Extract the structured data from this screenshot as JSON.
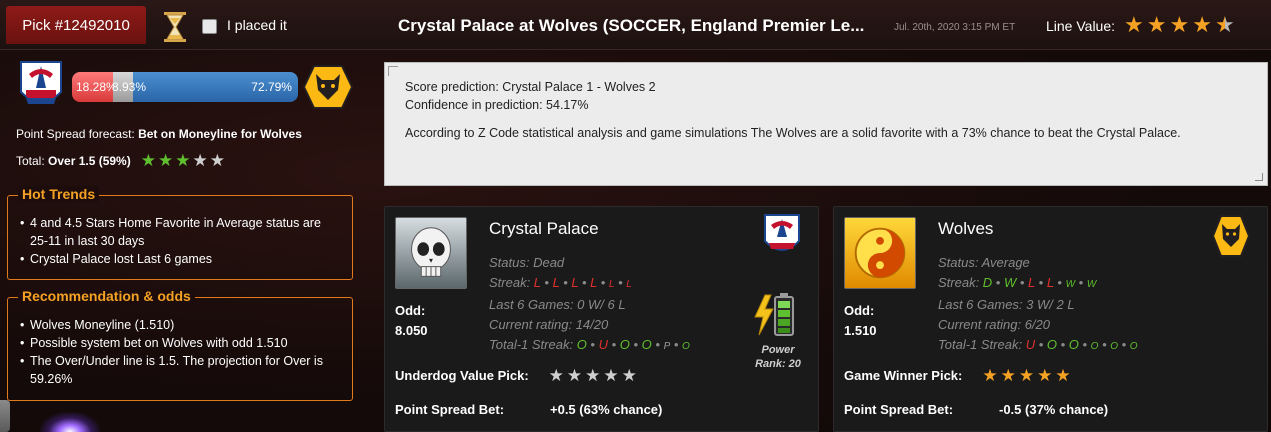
{
  "header": {
    "pick_label": "Pick #12492010",
    "placed_label": "I placed it",
    "match_title": "Crystal Palace at Wolves (SOCCER, England Premier Le...",
    "date": "Jul. 20th, 2020 3:15 PM ET",
    "line_value_label": "Line Value:",
    "line_value_stars": 4.5,
    "line_star_glyphs": [
      "★",
      "★",
      "★",
      "★",
      "★"
    ]
  },
  "probabilities": {
    "home": "18.28%",
    "draw": "8.93%",
    "away": "72.79%",
    "home_value": 18.28,
    "draw_value": 8.93,
    "away_value": 72.79
  },
  "forecast": {
    "spread_prefix": "Point Spread forecast: ",
    "spread_value": "Bet on Moneyline for Wolves",
    "total_prefix": "Total: ",
    "total_value": "Over 1.5 (59%)",
    "total_stars": 3,
    "total_star_glyphs": [
      "★",
      "★",
      "★",
      "★",
      "★"
    ]
  },
  "hot_trends": {
    "title": "Hot Trends",
    "items": [
      "4 and 4.5 Stars Home Favorite in Average status are 25-11 in last 30 days",
      "Crystal Palace lost Last 6 games"
    ]
  },
  "recommendation": {
    "title": "Recommendation & odds",
    "items": [
      "Wolves Moneyline (1.510)",
      "Possible system bet on Wolves with odd 1.510",
      "The Over/Under line is 1.5. The projection for Over is 59.26%"
    ]
  },
  "prediction": {
    "score": "Score prediction: Crystal Palace 1 - Wolves 2",
    "confidence": "Confidence in prediction: 54.17%",
    "analysis": "According to Z Code statistical analysis and game simulations The Wolves are a solid favorite with a 73% chance to beat the Crystal Palace."
  },
  "home_card": {
    "name": "Crystal Palace",
    "status": "Status: Dead",
    "streak_label": "Streak: ",
    "streak": [
      "L",
      "L",
      "L",
      "L",
      "L",
      "L"
    ],
    "last6": "Last 6 Games: 0 W/ 6 L",
    "rating": "Current rating: 14/20",
    "total_streak_label": "Total-1 Streak: ",
    "total_streak": [
      "O",
      "U",
      "O",
      "O",
      "P",
      "O"
    ],
    "odd_label": "Odd:",
    "odd_value": "8.050",
    "power_label": "Power",
    "power_rank": "Rank: 20",
    "pick_label": "Underdog Value Pick:",
    "pick_stars": 0,
    "pick_star_glyphs": [
      "★",
      "★",
      "★",
      "★",
      "★"
    ],
    "spread_label": "Point Spread Bet:",
    "spread_value": "+0.5 (63% chance)"
  },
  "away_card": {
    "name": "Wolves",
    "status": "Status: Average",
    "streak_label": "Streak: ",
    "streak": [
      "D",
      "W",
      "L",
      "L",
      "W",
      "W"
    ],
    "last6": "Last 6 Games: 3 W/ 2 L",
    "rating": "Current rating: 6/20",
    "total_streak_label": "Total-1 Streak: ",
    "total_streak": [
      "U",
      "O",
      "O",
      "O",
      "O",
      "O"
    ],
    "odd_label": "Odd:",
    "odd_value": "1.510",
    "pick_label": "Game Winner Pick:",
    "pick_stars": 5,
    "pick_star_glyphs": [
      "★",
      "★",
      "★",
      "★",
      "★"
    ],
    "spread_label": "Point Spread Bet:",
    "spread_value": "-0.5 (37% chance)"
  },
  "colors": {
    "accent_orange": "#f4a124",
    "header_red": "#8e1a17",
    "loss_red": "#e0302c",
    "win_green": "#5fbf2e"
  }
}
